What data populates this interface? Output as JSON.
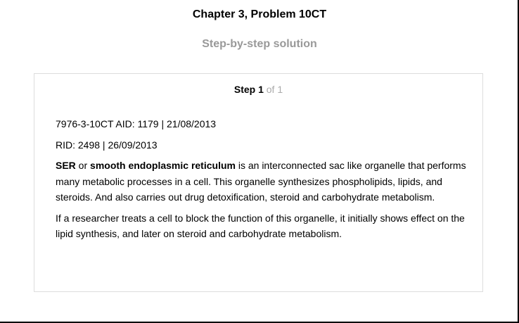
{
  "header": {
    "chapter_title": "Chapter 3, Problem 10CT",
    "solution_subtitle": "Step-by-step solution"
  },
  "step": {
    "step_label": "Step 1",
    "step_of": "of 1",
    "meta_line_1": "7976-3-10CT AID: 1179 | 21/08/2013",
    "meta_line_2": "RID: 2498 | 26/09/2013",
    "para1": {
      "term1": "SER",
      "connector": " or ",
      "term2": "smooth endoplasmic reticulum",
      "rest": " is an interconnected sac like organelle that performs many metabolic processes in a cell. This organelle synthesizes phospholipids, lipids, and steroids. And also carries out drug detoxification, steroid and carbohydrate metabolism."
    },
    "para2": "If a researcher treats a cell to block the function of this organelle, it initially shows effect on the lipid synthesis, and later on steroid and carbohydrate metabolism."
  }
}
